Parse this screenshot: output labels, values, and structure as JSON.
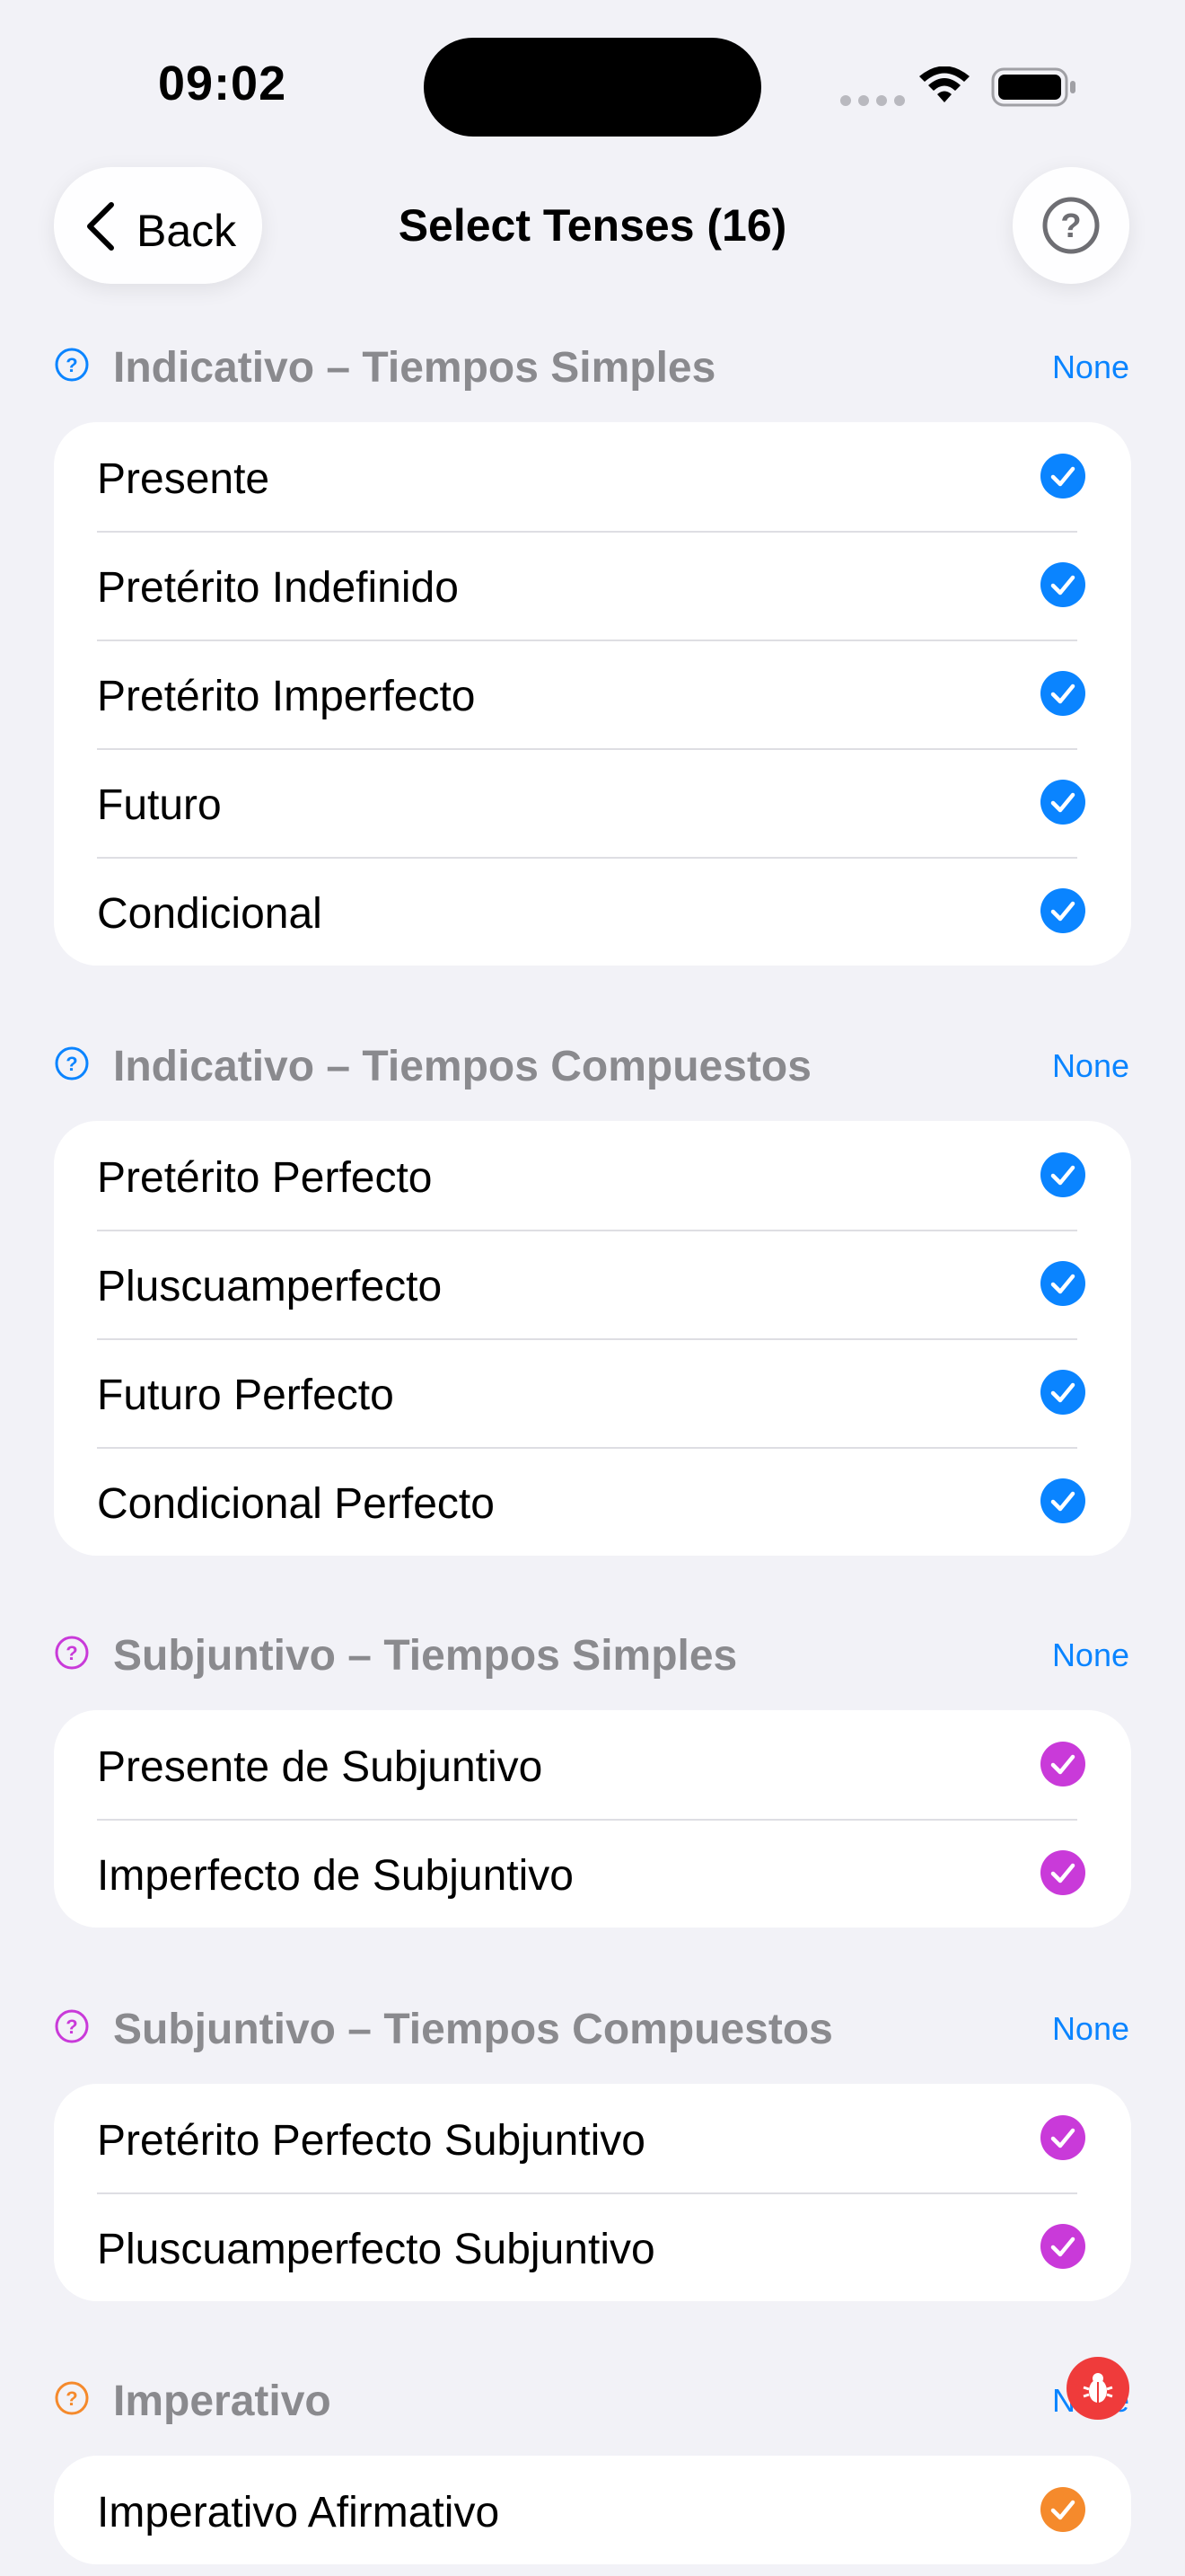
{
  "status_bar": {
    "time": "09:02"
  },
  "nav": {
    "back_label": "Back",
    "title": "Select Tenses (16)",
    "help_icon": "question-circle-icon"
  },
  "colors": {
    "indicativo": "#0a84ff",
    "subjuntivo": "#c93ad9",
    "imperativo": "#f58a2c",
    "section_title": "#8a8a8e",
    "background": "#f2f2f7"
  },
  "sections": [
    {
      "title": "Indicativo – Tiempos Simples",
      "none_label": "None",
      "items": [
        {
          "label": "Presente",
          "checked": true
        },
        {
          "label": "Pretérito Indefinido",
          "checked": true
        },
        {
          "label": "Pretérito Imperfecto",
          "checked": true
        },
        {
          "label": "Futuro",
          "checked": true
        },
        {
          "label": "Condicional",
          "checked": true
        }
      ]
    },
    {
      "title": "Indicativo – Tiempos Compuestos",
      "none_label": "None",
      "items": [
        {
          "label": "Pretérito Perfecto",
          "checked": true
        },
        {
          "label": "Pluscuamperfecto",
          "checked": true
        },
        {
          "label": "Futuro Perfecto",
          "checked": true
        },
        {
          "label": "Condicional Perfecto",
          "checked": true
        }
      ]
    },
    {
      "title": "Subjuntivo – Tiempos Simples",
      "none_label": "None",
      "items": [
        {
          "label": "Presente de Subjuntivo",
          "checked": true
        },
        {
          "label": "Imperfecto de Subjuntivo",
          "checked": true
        }
      ]
    },
    {
      "title": "Subjuntivo – Tiempos Compuestos",
      "none_label": "None",
      "items": [
        {
          "label": "Pretérito Perfecto Subjuntivo",
          "checked": true
        },
        {
          "label": "Pluscuamperfecto Subjuntivo",
          "checked": true
        }
      ]
    },
    {
      "title": "Imperativo",
      "none_label": "None",
      "items": [
        {
          "label": "Imperativo Afirmativo",
          "checked": true
        }
      ]
    }
  ],
  "debug_icon": "bug-icon"
}
